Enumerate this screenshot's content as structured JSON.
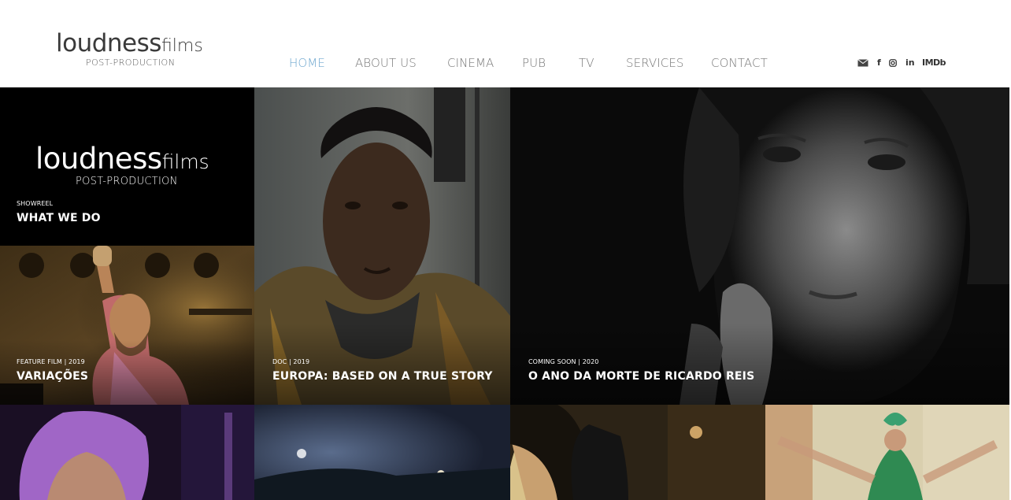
{
  "header": {
    "logo": {
      "main": "loudness",
      "accent": "films",
      "sub": "POST-PRODUCTION"
    },
    "nav": [
      {
        "label": "HOME",
        "active": true
      },
      {
        "label": "ABOUT US",
        "active": false
      },
      {
        "label": "CINEMA",
        "active": false
      },
      {
        "label": "PUB",
        "active": false
      },
      {
        "label": "TV",
        "active": false
      },
      {
        "label": "SERVICES",
        "active": false
      },
      {
        "label": "CONTACT",
        "active": false
      }
    ],
    "social": [
      {
        "icon": "mail-icon"
      },
      {
        "icon": "facebook-icon",
        "label": "f"
      },
      {
        "icon": "instagram-icon"
      },
      {
        "icon": "linkedin-icon",
        "label": "in"
      },
      {
        "icon": "imdb-icon",
        "label": "IMDb"
      }
    ]
  },
  "tiles": {
    "showreel": {
      "logo_main": "loudness",
      "logo_accent": "films",
      "logo_sub": "POST-PRODUCTION",
      "category": "SHOWREEL",
      "title": "WHAT WE DO"
    },
    "variacoes": {
      "category": "FEATURE FILM | 2019",
      "title": "VARIAÇÕES"
    },
    "europa": {
      "category": "DOC | 2019",
      "title": "EUROPA: BASED ON A TRUE STORY"
    },
    "ricardo_reis": {
      "category": "COMING SOON | 2020",
      "title": "O ANO DA MORTE DE RICARDO REIS"
    }
  },
  "colors": {
    "nav_active": "#6ea7cf",
    "nav_text": "#777777",
    "header_bg": "#ffffff"
  }
}
